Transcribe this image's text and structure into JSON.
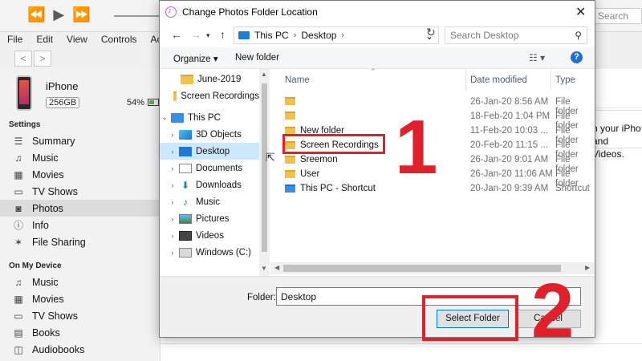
{
  "itunes": {
    "search_placeholder": "Search",
    "menu": [
      "File",
      "Edit",
      "View",
      "Controls",
      "Account"
    ],
    "device": {
      "name": "iPhone",
      "capacity": "256GB",
      "battery": "54%"
    },
    "settings_heading": "Settings",
    "settings_items": [
      "Summary",
      "Music",
      "Movies",
      "TV Shows",
      "Photos",
      "Info",
      "File Sharing"
    ],
    "on_device_heading": "On My Device",
    "on_device_items": [
      "Music",
      "Movies",
      "TV Shows",
      "Books",
      "Audiobooks"
    ],
    "peek_text": [
      "n your iPho",
      "and Videos."
    ]
  },
  "dialog": {
    "title": "Change Photos Folder Location",
    "address": {
      "root": "This PC",
      "current": "Desktop"
    },
    "search_placeholder": "Search Desktop",
    "organize_label": "Organize ▾",
    "new_folder_label": "New folder",
    "nav_items": [
      {
        "label": "June-2019",
        "icon": "folder"
      },
      {
        "label": "Screen Recordings",
        "icon": "folder"
      },
      {
        "label": "This PC",
        "icon": "pc"
      },
      {
        "label": "3D Objects",
        "icon": "3d"
      },
      {
        "label": "Desktop",
        "icon": "desktop"
      },
      {
        "label": "Documents",
        "icon": "documents"
      },
      {
        "label": "Downloads",
        "icon": "downloads"
      },
      {
        "label": "Music",
        "icon": "music"
      },
      {
        "label": "Pictures",
        "icon": "pictures"
      },
      {
        "label": "Videos",
        "icon": "videos"
      },
      {
        "label": "Windows (C:)",
        "icon": "drive"
      }
    ],
    "columns": {
      "name": "Name",
      "date": "Date modified",
      "type": "Type"
    },
    "files": [
      {
        "name": "",
        "date": "26-Jan-20 8:56 AM",
        "type": "File folder"
      },
      {
        "name": "",
        "date": "18-Feb-20 1:04 PM",
        "type": "File folder"
      },
      {
        "name": "New folder",
        "date": "11-Feb-20 10:03 ...",
        "type": "File folder"
      },
      {
        "name": "Screen Recordings",
        "date": "20-Feb-20 11:15 ...",
        "type": "File folder"
      },
      {
        "name": "Sreemon",
        "date": "26-Jan-20 9:01 AM",
        "type": "File folder"
      },
      {
        "name": "User",
        "date": "26-Jan-20 11:06 AM",
        "type": "File folder"
      },
      {
        "name": "This PC - Shortcut",
        "date": "20-Jan-20 9:39 AM",
        "type": "Shortcut"
      }
    ],
    "folder_label": "Folder:",
    "folder_value": "Desktop",
    "select_button": "Select Folder",
    "cancel_button": "Cancel"
  },
  "annotations": {
    "step1": "1",
    "step2": "2",
    "color": "#e0202a"
  }
}
